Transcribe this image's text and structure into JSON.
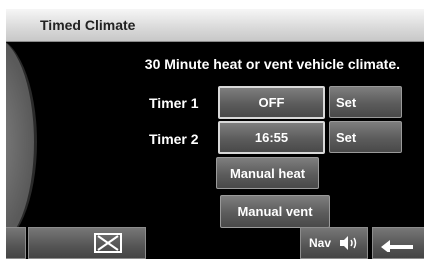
{
  "header": {
    "title": "Timed Climate"
  },
  "description": "30 Minute heat or vent vehicle climate.",
  "timers": [
    {
      "label": "Timer 1",
      "value": "OFF",
      "set_label": "Set"
    },
    {
      "label": "Timer 2",
      "value": "16:55",
      "set_label": "Set"
    }
  ],
  "actions": {
    "manual_heat": "Manual heat",
    "manual_vent": "Manual vent"
  },
  "footer": {
    "nav_label": "Nav",
    "icons": [
      "close-icon",
      "speaker-icon",
      "back-icon"
    ]
  }
}
